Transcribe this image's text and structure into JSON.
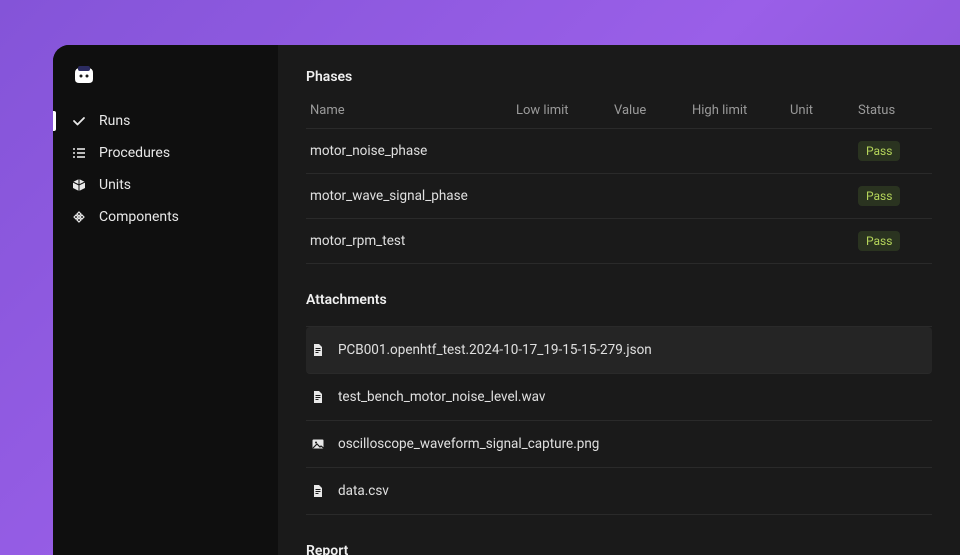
{
  "sidebar": {
    "items": [
      {
        "label": "Runs",
        "icon": "check-icon",
        "active": true
      },
      {
        "label": "Procedures",
        "icon": "list-icon",
        "active": false
      },
      {
        "label": "Units",
        "icon": "cube-icon",
        "active": false
      },
      {
        "label": "Components",
        "icon": "components-icon",
        "active": false
      }
    ]
  },
  "phases": {
    "title": "Phases",
    "columns": [
      "Name",
      "Low limit",
      "Value",
      "High limit",
      "Unit",
      "Status"
    ],
    "rows": [
      {
        "name": "motor_noise_phase",
        "low": "",
        "value": "",
        "high": "",
        "unit": "",
        "status": "Pass"
      },
      {
        "name": "motor_wave_signal_phase",
        "low": "",
        "value": "",
        "high": "",
        "unit": "",
        "status": "Pass"
      },
      {
        "name": "motor_rpm_test",
        "low": "",
        "value": "",
        "high": "",
        "unit": "",
        "status": "Pass"
      }
    ]
  },
  "attachments": {
    "title": "Attachments",
    "items": [
      {
        "name": "PCB001.openhtf_test.2024-10-17_19-15-15-279.json",
        "icon": "file-icon",
        "highlighted": true
      },
      {
        "name": "test_bench_motor_noise_level.wav",
        "icon": "file-icon",
        "highlighted": false
      },
      {
        "name": "oscilloscope_waveform_signal_capture.png",
        "icon": "image-icon",
        "highlighted": false
      },
      {
        "name": "data.csv",
        "icon": "file-icon",
        "highlighted": false
      }
    ]
  },
  "report": {
    "title": "Report"
  }
}
